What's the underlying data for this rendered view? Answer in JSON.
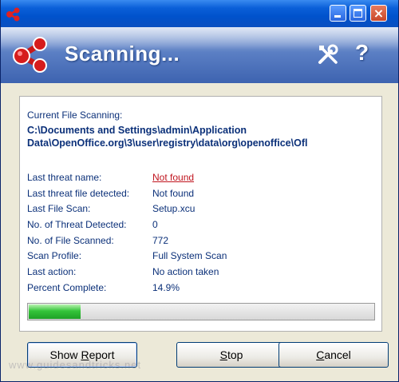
{
  "window": {
    "title": ""
  },
  "banner": {
    "title": "Scanning..."
  },
  "scan": {
    "current_label": "Current File Scanning:",
    "current_path_line1": "C:\\Documents and Settings\\admin\\Application",
    "current_path_line2": "Data\\OpenOffice.org\\3\\user\\registry\\data\\org\\openoffice\\Ofl",
    "rows": [
      {
        "label": "Last threat name:",
        "value": "Not found"
      },
      {
        "label": "Last threat file detected:",
        "value": "Not found"
      },
      {
        "label": "Last File Scan:",
        "value": "Setup.xcu"
      },
      {
        "label": "No. of Threat Detected:",
        "value": "0"
      },
      {
        "label": "No. of File Scanned:",
        "value": "772"
      },
      {
        "label": "Scan Profile:",
        "value": "Full System Scan"
      },
      {
        "label": "Last action:",
        "value": "No action taken"
      },
      {
        "label": "Percent Complete:",
        "value": "14.9%"
      }
    ],
    "progress_fraction": 0.149
  },
  "buttons": {
    "report_pre": "Show ",
    "report_ul": "R",
    "report_post": "eport",
    "stop_ul": "S",
    "stop_post": "top",
    "cancel_ul": "C",
    "cancel_post": "ancel"
  },
  "watermark": "www.guidesandtricks.net",
  "colors": {
    "accent": "#0b3079",
    "threat_link": "#c0141e",
    "progress": "#35c43a"
  },
  "icons": {
    "app": "app-logo-icon",
    "tools": "tools-icon",
    "help": "help-icon"
  }
}
